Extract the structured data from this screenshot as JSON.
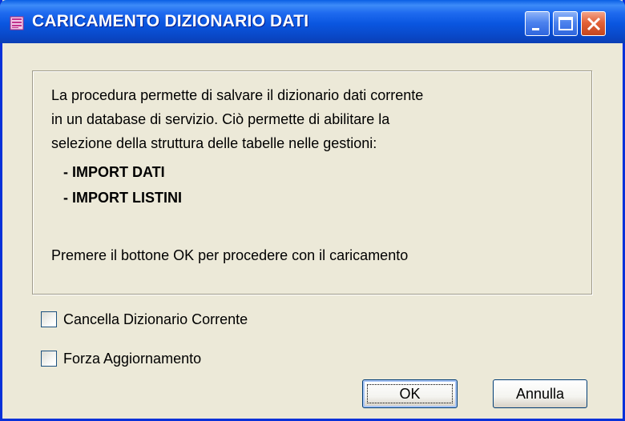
{
  "window": {
    "title": "CARICAMENTO DIZIONARIO DATI",
    "accent_color": "#0A56E0",
    "close_color": "#E36238"
  },
  "message": {
    "line1": "La procedura permette di salvare il dizionario dati corrente",
    "line2": "in un database di servizio. Ciò permette di abilitare la",
    "line3": "selezione della struttura delle tabelle nelle gestioni:",
    "item1": "- IMPORT DATI",
    "item2": "- IMPORT LISTINI",
    "footer": "Premere il bottone OK per procedere con il caricamento"
  },
  "options": {
    "clear_current": {
      "label": "Cancella Dizionario Corrente",
      "checked": false
    },
    "force_update": {
      "label": "Forza Aggiornamento",
      "checked": false
    }
  },
  "buttons": {
    "ok_label": "OK",
    "cancel_label": "Annulla"
  }
}
